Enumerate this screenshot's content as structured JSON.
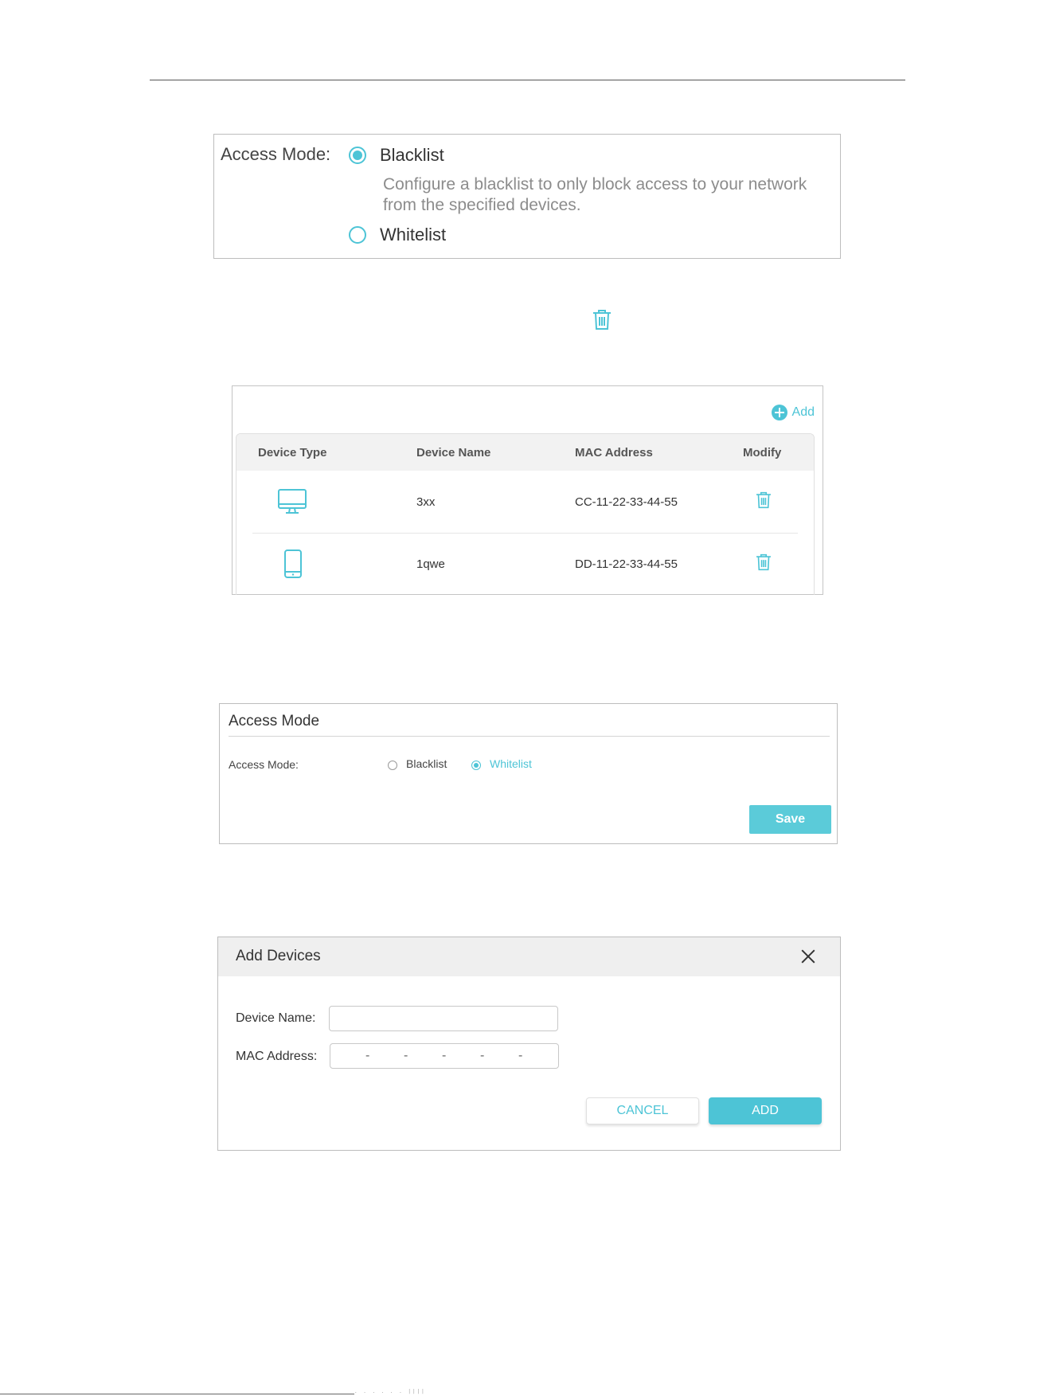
{
  "panel1": {
    "label": "Access Mode:",
    "option_blacklist": "Blacklist",
    "description": "Configure a blacklist to only block access to your network from the specified devices.",
    "option_whitelist": "Whitelist",
    "selected": "Blacklist"
  },
  "device_table": {
    "add_label": "Add",
    "headers": [
      "Device Type",
      "Device Name",
      "MAC Address",
      "Modify"
    ],
    "rows": [
      {
        "device_type_icon": "monitor-icon",
        "device_name": "3xx",
        "mac": "CC-11-22-33-44-55",
        "modify_icon": "trash-icon"
      },
      {
        "device_type_icon": "phone-icon",
        "device_name": "1qwe",
        "mac": "DD-11-22-33-44-55",
        "modify_icon": "trash-icon"
      }
    ]
  },
  "panel3": {
    "title": "Access Mode",
    "label": "Access Mode:",
    "option_blacklist": "Blacklist",
    "option_whitelist": "Whitelist",
    "selected": "Whitelist",
    "save_label": "Save"
  },
  "add_devices": {
    "title": "Add Devices",
    "device_name_label": "Device Name:",
    "device_name_value": "",
    "mac_label": "MAC Address:",
    "mac_separator": "-",
    "cancel_label": "CANCEL",
    "add_label": "ADD"
  },
  "colors": {
    "accent": "#4dc4d6",
    "button": "#5bcbd9",
    "muted_text": "#8c8c8c",
    "header_bg": "#efefef"
  }
}
